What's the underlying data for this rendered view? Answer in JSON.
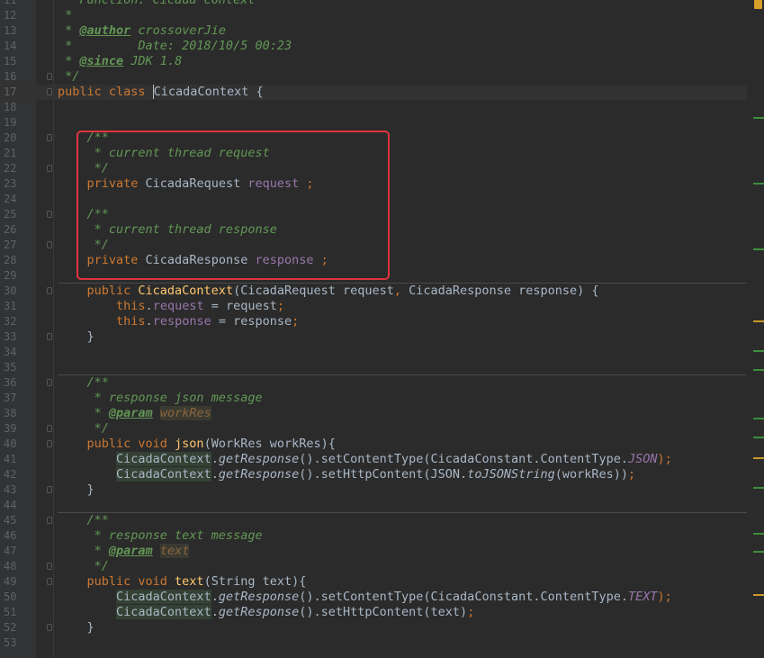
{
  "lines": [
    {
      "n": "11",
      "code": [
        {
          "t": " * Function: Cicada context",
          "c": "c-doc"
        }
      ]
    },
    {
      "n": "12",
      "code": [
        {
          "t": " *",
          "c": "c-doc"
        }
      ]
    },
    {
      "n": "13",
      "code": [
        {
          "t": " * ",
          "c": "c-doc"
        },
        {
          "t": "@author",
          "c": "c-tag"
        },
        {
          "t": " crossoverJie",
          "c": "c-doc"
        }
      ]
    },
    {
      "n": "14",
      "code": [
        {
          "t": " *         Date: 2018/10/5 00:23",
          "c": "c-doc"
        }
      ]
    },
    {
      "n": "15",
      "code": [
        {
          "t": " * ",
          "c": "c-doc"
        },
        {
          "t": "@since",
          "c": "c-tag"
        },
        {
          "t": " JDK 1.8",
          "c": "c-doc"
        }
      ]
    },
    {
      "n": "16",
      "code": [
        {
          "t": " */",
          "c": "c-doc"
        }
      ]
    },
    {
      "n": "17",
      "current": true,
      "code": [
        {
          "t": "public class ",
          "c": "c-kw"
        },
        {
          "t": "CicadaContext",
          "c": "c-type caret-cls"
        },
        {
          "t": " {",
          "c": "c-type"
        }
      ]
    },
    {
      "n": "18",
      "code": []
    },
    {
      "n": "19",
      "code": []
    },
    {
      "n": "20",
      "code": [
        {
          "t": "    /**",
          "c": "c-doc"
        }
      ]
    },
    {
      "n": "21",
      "code": [
        {
          "t": "     * current thread request",
          "c": "c-doc"
        }
      ]
    },
    {
      "n": "22",
      "code": [
        {
          "t": "     */",
          "c": "c-doc"
        }
      ]
    },
    {
      "n": "23",
      "code": [
        {
          "t": "    private ",
          "c": "c-kw"
        },
        {
          "t": "CicadaRequest ",
          "c": "c-type"
        },
        {
          "t": "request",
          "c": "c-field"
        },
        {
          "t": " ;",
          "c": "c-kw"
        }
      ]
    },
    {
      "n": "24",
      "code": []
    },
    {
      "n": "25",
      "code": [
        {
          "t": "    /**",
          "c": "c-doc"
        }
      ]
    },
    {
      "n": "26",
      "code": [
        {
          "t": "     * current thread response",
          "c": "c-doc"
        }
      ]
    },
    {
      "n": "27",
      "code": [
        {
          "t": "     */",
          "c": "c-doc"
        }
      ]
    },
    {
      "n": "28",
      "code": [
        {
          "t": "    private ",
          "c": "c-kw"
        },
        {
          "t": "CicadaResponse ",
          "c": "c-type"
        },
        {
          "t": "response",
          "c": "c-field"
        },
        {
          "t": " ;",
          "c": "c-kw"
        }
      ]
    },
    {
      "n": "29",
      "sep": true,
      "code": []
    },
    {
      "n": "30",
      "code": [
        {
          "t": "    public ",
          "c": "c-kw"
        },
        {
          "t": "CicadaContext",
          "c": "c-fn"
        },
        {
          "t": "(CicadaRequest request",
          "c": "c-type"
        },
        {
          "t": ", ",
          "c": "c-kw"
        },
        {
          "t": "CicadaResponse response) {",
          "c": "c-type"
        }
      ]
    },
    {
      "n": "31",
      "code": [
        {
          "t": "        this",
          "c": "c-kw"
        },
        {
          "t": ".",
          "c": "c-type"
        },
        {
          "t": "request",
          "c": "c-field"
        },
        {
          "t": " = request",
          "c": "c-type"
        },
        {
          "t": ";",
          "c": "c-kw"
        }
      ]
    },
    {
      "n": "32",
      "code": [
        {
          "t": "        this",
          "c": "c-kw"
        },
        {
          "t": ".",
          "c": "c-type"
        },
        {
          "t": "response",
          "c": "c-field"
        },
        {
          "t": " = response",
          "c": "c-type"
        },
        {
          "t": ";",
          "c": "c-kw"
        }
      ]
    },
    {
      "n": "33",
      "code": [
        {
          "t": "    }",
          "c": "c-type"
        }
      ]
    },
    {
      "n": "34",
      "code": []
    },
    {
      "n": "35",
      "sep": true,
      "code": []
    },
    {
      "n": "36",
      "code": [
        {
          "t": "    /**",
          "c": "c-doc"
        }
      ]
    },
    {
      "n": "37",
      "code": [
        {
          "t": "     * response json message",
          "c": "c-doc"
        }
      ]
    },
    {
      "n": "38",
      "code": [
        {
          "t": "     * ",
          "c": "c-doc"
        },
        {
          "t": "@param",
          "c": "c-tag"
        },
        {
          "t": " ",
          "c": "c-doc"
        },
        {
          "t": "workRes",
          "c": "c-param"
        }
      ]
    },
    {
      "n": "39",
      "code": [
        {
          "t": "     */",
          "c": "c-doc"
        }
      ]
    },
    {
      "n": "40",
      "code": [
        {
          "t": "    public void ",
          "c": "c-kw"
        },
        {
          "t": "json",
          "c": "c-fn"
        },
        {
          "t": "(WorkRes workRes){",
          "c": "c-type"
        }
      ]
    },
    {
      "n": "41",
      "code": [
        {
          "t": "        ",
          "c": "c-type"
        },
        {
          "t": "CicadaContext",
          "c": "c-type c-usage"
        },
        {
          "t": ".",
          "c": "c-type"
        },
        {
          "t": "getResponse",
          "c": "c-static"
        },
        {
          "t": "().setContentType(CicadaConstant.ContentType.",
          "c": "c-type"
        },
        {
          "t": "JSON",
          "c": "c-field-i"
        },
        {
          "t": ");",
          "c": "c-kw"
        }
      ]
    },
    {
      "n": "42",
      "code": [
        {
          "t": "        ",
          "c": "c-type"
        },
        {
          "t": "CicadaContext",
          "c": "c-type c-usage"
        },
        {
          "t": ".",
          "c": "c-type"
        },
        {
          "t": "getResponse",
          "c": "c-static"
        },
        {
          "t": "().setHttpContent(JSON.",
          "c": "c-type"
        },
        {
          "t": "toJSONString",
          "c": "c-static"
        },
        {
          "t": "(workRes))",
          "c": "c-type"
        },
        {
          "t": ";",
          "c": "c-kw"
        }
      ]
    },
    {
      "n": "43",
      "code": [
        {
          "t": "    }",
          "c": "c-type"
        }
      ]
    },
    {
      "n": "44",
      "sep": true,
      "code": []
    },
    {
      "n": "45",
      "code": [
        {
          "t": "    /**",
          "c": "c-doc"
        }
      ]
    },
    {
      "n": "46",
      "code": [
        {
          "t": "     * response text message",
          "c": "c-doc"
        }
      ]
    },
    {
      "n": "47",
      "code": [
        {
          "t": "     * ",
          "c": "c-doc"
        },
        {
          "t": "@param",
          "c": "c-tag"
        },
        {
          "t": " ",
          "c": "c-doc"
        },
        {
          "t": "text",
          "c": "c-param"
        }
      ]
    },
    {
      "n": "48",
      "code": [
        {
          "t": "     */",
          "c": "c-doc"
        }
      ]
    },
    {
      "n": "49",
      "code": [
        {
          "t": "    public void ",
          "c": "c-kw"
        },
        {
          "t": "text",
          "c": "c-fn"
        },
        {
          "t": "(String text){",
          "c": "c-type"
        }
      ]
    },
    {
      "n": "50",
      "code": [
        {
          "t": "        ",
          "c": "c-type"
        },
        {
          "t": "CicadaContext",
          "c": "c-type c-usage"
        },
        {
          "t": ".",
          "c": "c-type"
        },
        {
          "t": "getResponse",
          "c": "c-static"
        },
        {
          "t": "().setContentType(CicadaConstant.ContentType.",
          "c": "c-type"
        },
        {
          "t": "TEXT",
          "c": "c-field-i"
        },
        {
          "t": ");",
          "c": "c-kw"
        }
      ]
    },
    {
      "n": "51",
      "code": [
        {
          "t": "        ",
          "c": "c-type"
        },
        {
          "t": "CicadaContext",
          "c": "c-type c-usage"
        },
        {
          "t": ".",
          "c": "c-type"
        },
        {
          "t": "getResponse",
          "c": "c-static"
        },
        {
          "t": "().setHttpContent(text)",
          "c": "c-type"
        },
        {
          "t": ";",
          "c": "c-kw"
        }
      ]
    },
    {
      "n": "52",
      "code": [
        {
          "t": "    }",
          "c": "c-type"
        }
      ]
    },
    {
      "n": "53",
      "code": []
    }
  ]
}
